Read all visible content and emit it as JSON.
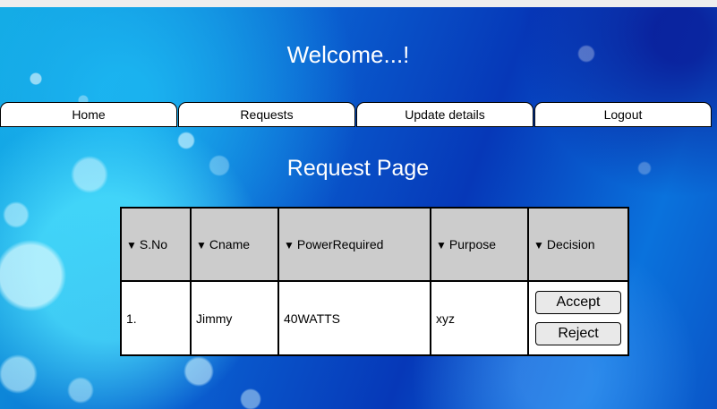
{
  "header": {
    "welcome": "Welcome...!"
  },
  "nav": {
    "items": [
      {
        "label": "Home"
      },
      {
        "label": "Requests"
      },
      {
        "label": "Update details"
      },
      {
        "label": "Logout"
      }
    ]
  },
  "main": {
    "title": "Request Page",
    "sort_glyph": "▼",
    "table": {
      "columns": [
        "S.No",
        "Cname",
        "PowerRequired",
        "Purpose",
        "Decision"
      ],
      "rows": [
        {
          "sno": "1.",
          "cname": "Jimmy",
          "power": "40WATTS",
          "purpose": "xyz",
          "accept_label": "Accept",
          "reject_label": "Reject"
        }
      ]
    }
  },
  "colors": {
    "background_light": "#0fa5df",
    "background_dark": "#0638b8",
    "header_cell": "#cccccc",
    "button_bg": "#e9e9e9"
  }
}
